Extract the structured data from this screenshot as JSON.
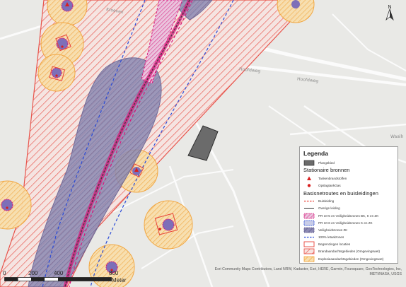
{
  "map": {
    "road_labels": [
      "Kroeven",
      "Hoofdweg",
      "Hoofdweg",
      "Waalh"
    ],
    "colors": {
      "background": "#e9e9e6",
      "buffer_red": "#e8443b",
      "buffer_orange": "#f2a43a",
      "zone_purple": "#6e6c9a",
      "pipeline_magenta": "#d9187c",
      "pipeline_blue": "#2a4bd7",
      "plangebied": "#6b6b6b"
    },
    "north_label": "N"
  },
  "legend": {
    "title": "Legenda",
    "items_top": [
      {
        "label": "Plangebied",
        "icon": "plangebied-swatch"
      }
    ],
    "section_sources": "Stationaire bronnen",
    "sources": [
      {
        "label": "Tankenbrandstoffen",
        "icon": "red-triangle-icon"
      },
      {
        "label": "OpslagtankGas",
        "icon": "red-dot-icon"
      }
    ],
    "section_routes": "Basisnetroutes en buisleidingen",
    "routes": [
      {
        "label": "Buisleiding",
        "icon": "red-dashed-line"
      },
      {
        "label": "Overige leiding",
        "icon": "dark-solid-line"
      },
      {
        "label": "PR 10-5 en Veiligheidszones BK, K en ZK",
        "icon": "magenta-dashed-hatch-swatch"
      },
      {
        "label": "PR 10-6 en Veiligheidszones K en ZK",
        "icon": "blue-dashed-hatch-swatch"
      },
      {
        "label": "Veiligheidszones ZK",
        "icon": "purple-dashed-hatch-swatch"
      },
      {
        "label": "100% letaalzones",
        "icon": "blue-dashed-line"
      },
      {
        "label": "Begrenzingen locaties",
        "icon": "red-outline-swatch"
      },
      {
        "label": "Brandaandachtsgebieden (Omgevingswet)",
        "icon": "red-hatch-swatch"
      },
      {
        "label": "Explosieaandachtsgebieden (Omgevingswet)",
        "icon": "orange-hatch-swatch"
      }
    ]
  },
  "scalebar": {
    "ticks": [
      "0",
      "200",
      "400",
      "800"
    ],
    "unit": "Meter"
  },
  "attribution": {
    "line1": "Esri Community Maps Contributors, Land NRW, Kadaster, Esri, HERE, Garmin, Foursquare, GeoTechnologies, Inc,",
    "line2": "METI/NASA, USGS"
  }
}
